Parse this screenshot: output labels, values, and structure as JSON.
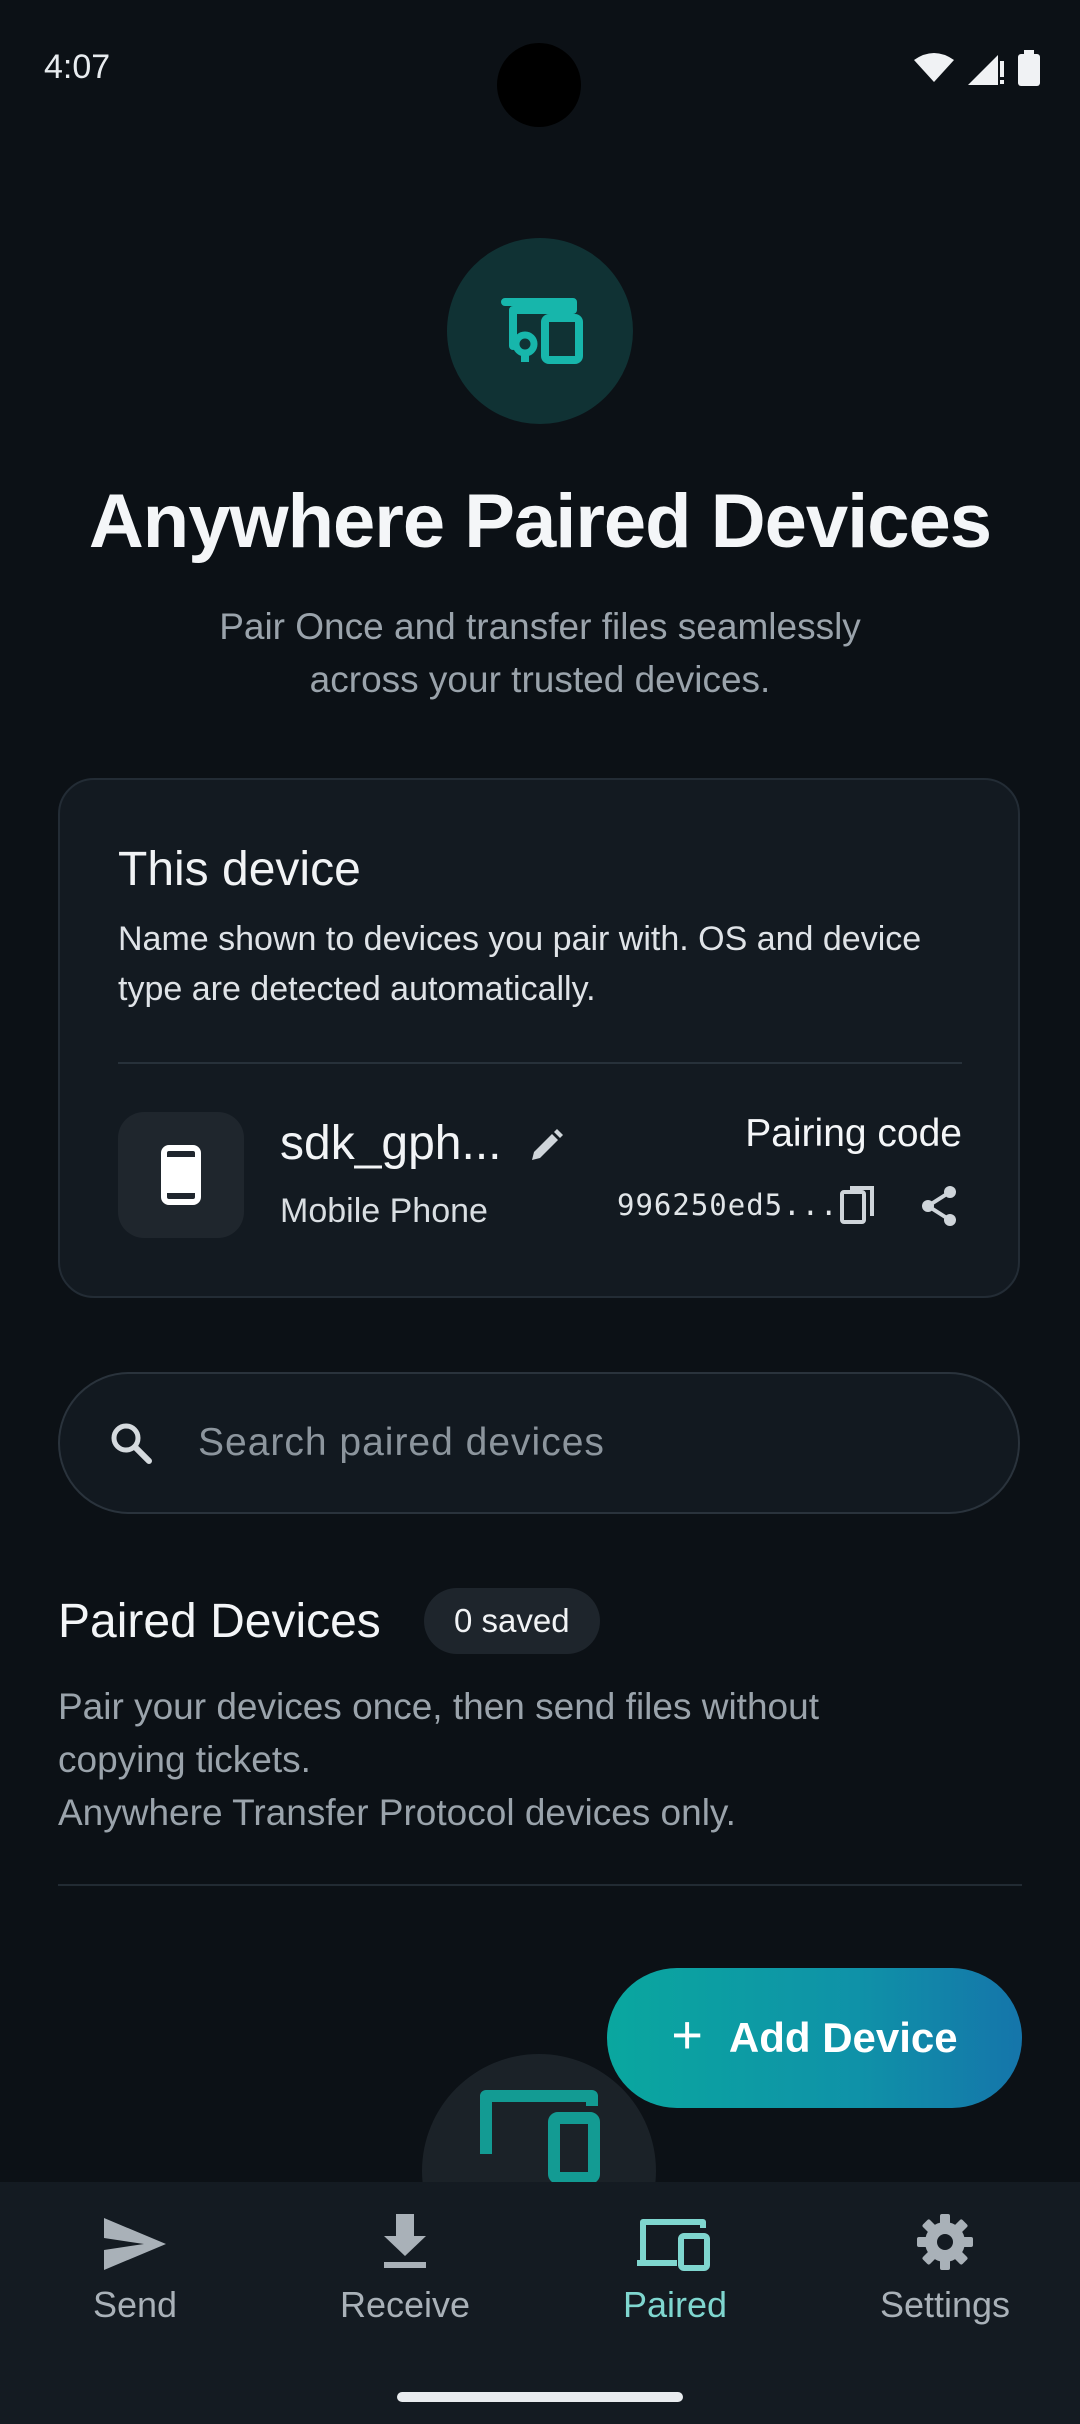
{
  "status_bar": {
    "time": "4:07"
  },
  "hero": {
    "icon": "devices-icon",
    "title": "Anywhere Paired Devices",
    "subtitle_line1": "Pair Once and transfer files seamlessly",
    "subtitle_line2": "across your trusted devices."
  },
  "this_device": {
    "title": "This device",
    "description": "Name shown to devices you pair with. OS and device type are detected automatically.",
    "name": "sdk_gph...",
    "type": "Mobile Phone",
    "pairing_label": "Pairing code",
    "pairing_code": "996250ed5..."
  },
  "search": {
    "placeholder": "Search paired devices",
    "value": ""
  },
  "paired": {
    "title": "Paired Devices",
    "badge": "0 saved",
    "desc_line1": "Pair your devices once, then send files without",
    "desc_line2": "copying tickets.",
    "desc_line3": "Anywhere Transfer Protocol devices only."
  },
  "fab": {
    "label": "Add Device",
    "icon": "plus-icon"
  },
  "nav": {
    "items": [
      {
        "label": "Send",
        "icon": "send-icon",
        "active": false
      },
      {
        "label": "Receive",
        "icon": "download-icon",
        "active": false
      },
      {
        "label": "Paired",
        "icon": "devices-icon",
        "active": true
      },
      {
        "label": "Settings",
        "icon": "gear-icon",
        "active": false
      }
    ]
  },
  "colors": {
    "accent": "#14b8ae",
    "active_nav": "#7fd6cf",
    "background": "#0c1116"
  }
}
